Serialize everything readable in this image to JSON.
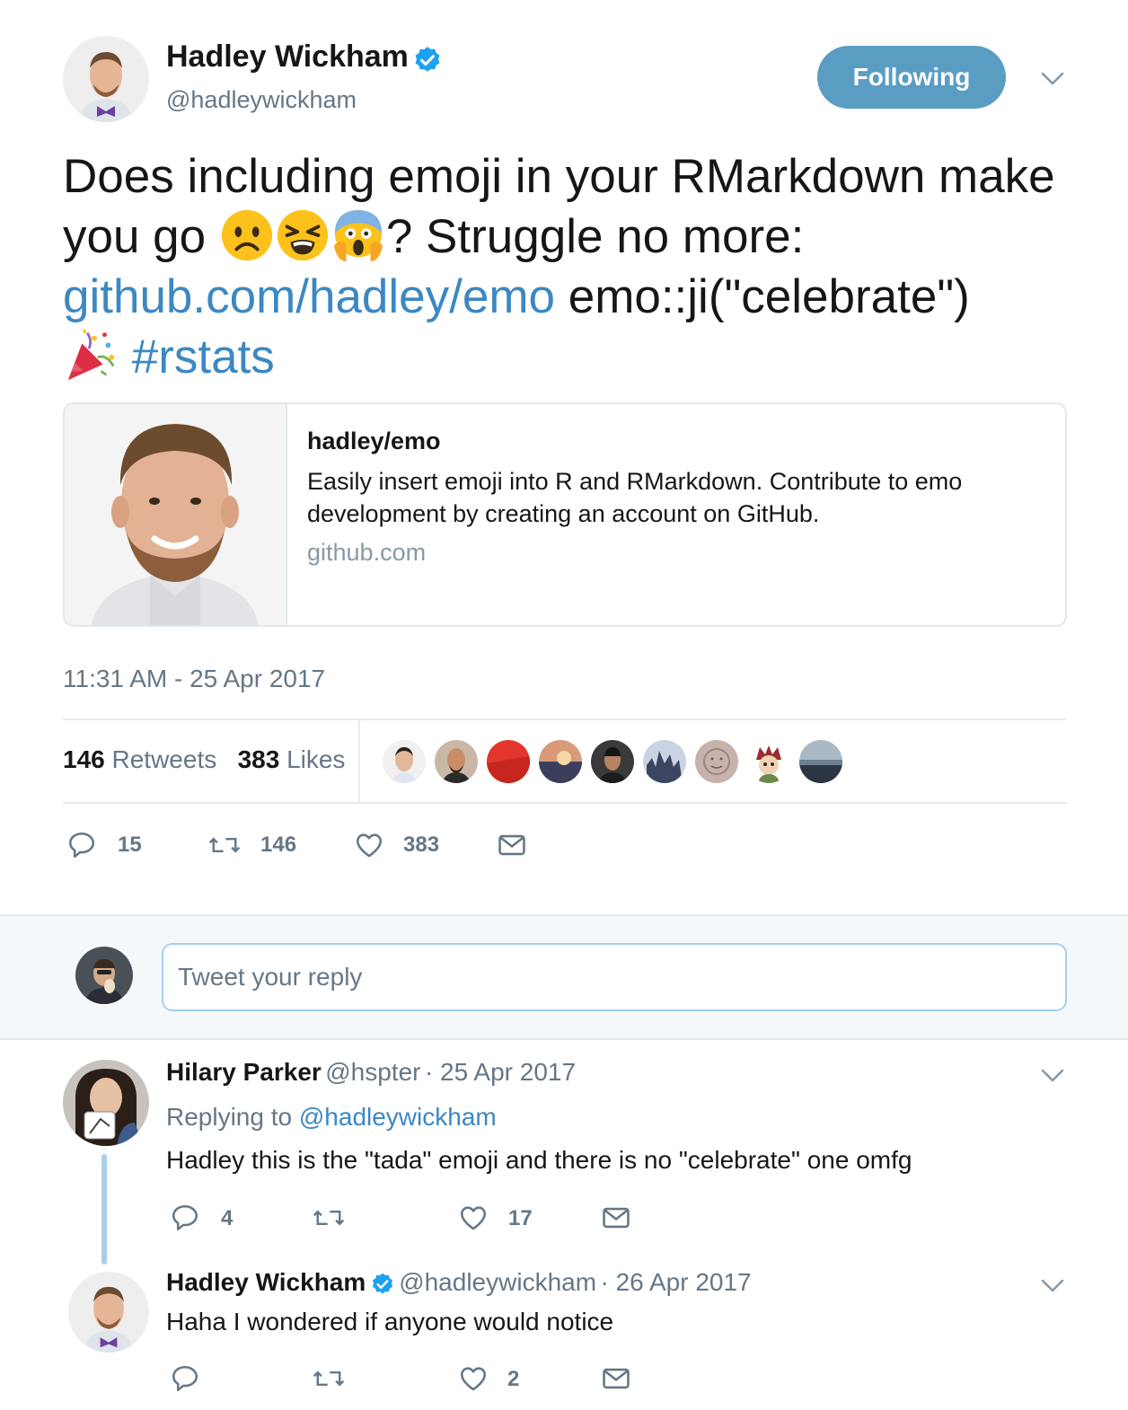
{
  "tweet": {
    "author_name": "Hadley Wickham",
    "author_handle": "@hadleywickham",
    "follow_label": "Following",
    "text_part1": "Does including emoji in your RMarkdown make you go ",
    "text_part2": "? Struggle no more: ",
    "link": "github.com/hadley/emo",
    "text_part3": " emo::ji(\"celebrate\") ",
    "hashtag": "#rstats",
    "emojis": [
      "frowning-face",
      "tired-face",
      "scream-face",
      "party-popper"
    ],
    "timestamp": "11:31 AM - 25 Apr 2017"
  },
  "card": {
    "title": "hadley/emo",
    "description": "Easily insert emoji into R and RMarkdown. Contribute to emo development by creating an account on GitHub.",
    "domain": "github.com"
  },
  "stats": {
    "retweets_count": "146",
    "retweets_label": "Retweets",
    "likes_count": "383",
    "likes_label": "Likes"
  },
  "actions": {
    "replies": "15",
    "retweets": "146",
    "likes": "383"
  },
  "reply_box": {
    "placeholder": "Tweet your reply"
  },
  "replies": [
    {
      "name": "Hilary Parker",
      "handle": "@hspter",
      "date": "· 25 Apr 2017",
      "replying_prefix": "Replying to ",
      "replying_to": "@hadleywickham",
      "text": "Hadley this is the \"tada\" emoji and there is no \"celebrate\" one omfg",
      "replies": "4",
      "retweets": "",
      "likes": "17"
    },
    {
      "name": "Hadley Wickham",
      "handle": "@hadleywickham",
      "date": "· 26 Apr 2017",
      "text": "Haha I wondered if anyone would notice",
      "replies": "",
      "retweets": "",
      "likes": "2"
    }
  ],
  "colors": {
    "accent": "#1da1f2",
    "follow_button": "#5a9dc3",
    "link": "#3b88c3",
    "muted": "#657786"
  }
}
